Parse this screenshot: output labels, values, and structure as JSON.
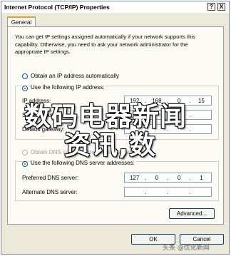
{
  "window": {
    "title": "Internet Protocol (TCP/IP) Properties",
    "help_label": "?",
    "close_label": "X"
  },
  "tabs": [
    {
      "label": "General"
    }
  ],
  "description": "You can get IP settings assigned automatically if your network supports this capability. Otherwise, you need to ask your network administrator for the appropriate IP settings.",
  "ip_section": {
    "auto_label": "Obtain an IP address automatically",
    "manual_label": "Use the following IP address:",
    "ip_label": "IP address:",
    "ip_value": [
      "192",
      "168",
      "0",
      "15"
    ],
    "subnet_label": "Subnet mask:",
    "gateway_label": "Default gateway:"
  },
  "dns_section": {
    "auto_label": "Obtain DNS server address automatically",
    "manual_label": "Use the following DNS server addresses:",
    "preferred_label": "Preferred DNS server:",
    "preferred_value": [
      "127",
      "0",
      "0",
      "1"
    ],
    "alternate_label": "Alternate DNS server:",
    "alternate_value": [
      "",
      "",
      "",
      ""
    ]
  },
  "buttons": {
    "advanced": "Advanced...",
    "ok": "OK",
    "cancel": "Cancel"
  },
  "overlay": {
    "line1": "数码电器新闻",
    "line2": "资讯,数"
  },
  "watermark": "头条 @优化新闻"
}
